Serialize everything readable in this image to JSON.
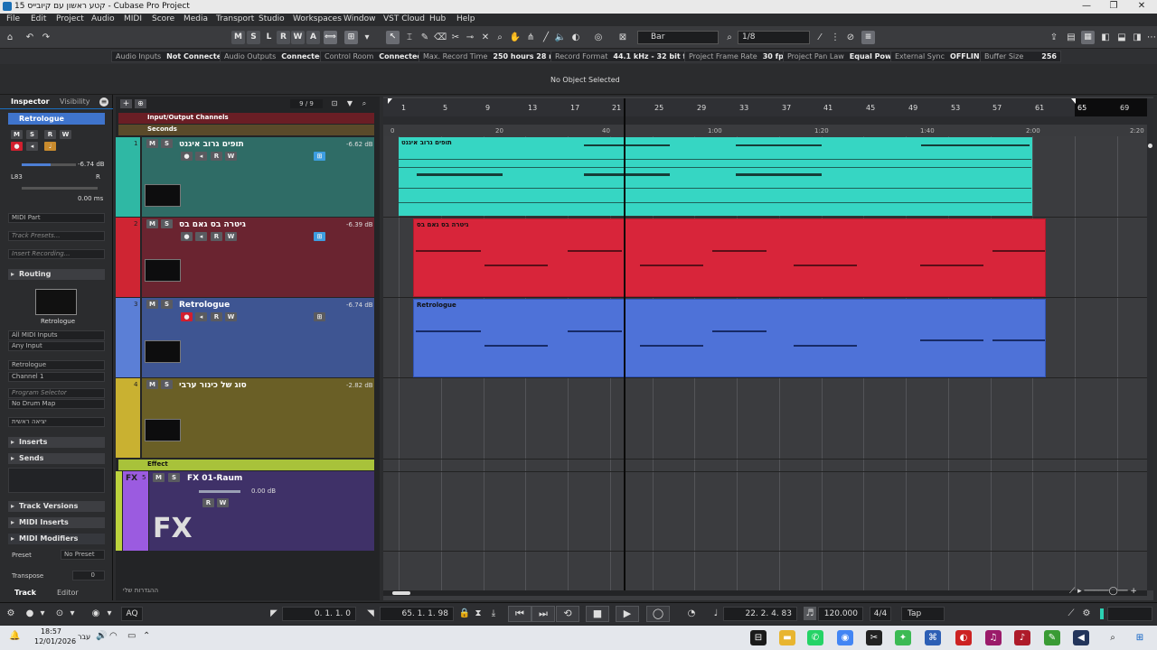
{
  "window": {
    "title": "קטע ראשון עם קיובייס 15 - Cubase Pro Project",
    "min": "—",
    "max": "❐",
    "close": "✕"
  },
  "menu": [
    "File",
    "Edit",
    "Project",
    "Audio",
    "MIDI",
    "Score",
    "Media",
    "Transport",
    "Studio",
    "Workspaces",
    "Window",
    "VST Cloud",
    "Hub",
    "Help"
  ],
  "toolbar": {
    "msl": [
      "M",
      "S",
      "L",
      "R",
      "W",
      "A"
    ],
    "grid_type": "Bar",
    "quantize": "1/8"
  },
  "status": [
    {
      "label": "Audio Inputs",
      "value": "Not Connected"
    },
    {
      "label": "Audio Outputs",
      "value": "Connected"
    },
    {
      "label": "Control Room",
      "value": "Connected"
    },
    {
      "label": "Max. Record Time",
      "value": "250 hours 28 mins"
    },
    {
      "label": "Record Format",
      "value": "44.1 kHz - 32 bit float"
    },
    {
      "label": "Project Frame Rate",
      "value": "30 fps"
    },
    {
      "label": "Project Pan Law",
      "value": "Equal Power"
    },
    {
      "label": "External Sync",
      "value": "OFFLINE"
    },
    {
      "label": "Buffer Size",
      "value": "256"
    }
  ],
  "info_line": "No Object Selected",
  "inspector": {
    "tabs": [
      "Inspector",
      "Visibility"
    ],
    "track_name": "Retrologue",
    "volume": "-6.74 dB",
    "pan_l": "L83",
    "pan_r": "R",
    "delay": "0.00 ms",
    "midi_part": "MIDI Part",
    "track_presets": "Track Presets...",
    "insert_recording": "Insert Recording...",
    "routing": "Routing",
    "instrument_label": "Retrologue",
    "midi_input": "All MIDI Inputs",
    "any_input": "Any Input",
    "output": "Retrologue",
    "channel": "Channel 1",
    "program_selector": "Program Selector",
    "drum_map": "No Drum Map",
    "output_name": "יציאה ראשית",
    "sections": [
      "Inserts",
      "Sends",
      "Track Versions",
      "MIDI Inserts",
      "MIDI Modifiers"
    ],
    "preset_label": "Preset",
    "preset_value": "No Preset",
    "transpose_label": "Transpose",
    "transpose_value": "0",
    "bottom_tabs": [
      "Track",
      "Editor"
    ]
  },
  "tracklist": {
    "count": "9 / 9",
    "io_label": "Input/Output Channels",
    "seconds_label": "Seconds",
    "tracks": [
      {
        "num": "1",
        "name": "תופים גרוב איגנט",
        "vol": "-6.62 dB",
        "color": "#2fb8a4",
        "body": "#2f6c66"
      },
      {
        "num": "2",
        "name": "גיטרה בס גאם בס",
        "vol": "-6.39 dB",
        "color": "#cf2533",
        "body": "#6a2430"
      },
      {
        "num": "3",
        "name": "Retrologue",
        "vol": "-6.74 dB",
        "color": "#5b7fd6",
        "body": "#3e5592"
      },
      {
        "num": "4",
        "name": "סוג של כינור ערבי",
        "vol": "-2.82 dB",
        "color": "#c9b131",
        "body": "#6a5f26"
      }
    ],
    "effect_folder": "Effect",
    "fx_track": {
      "num": "5",
      "name": "FX 01-Raum",
      "vol": "0.00 dB"
    },
    "footer": "ההגדרות שלי"
  },
  "ruler": {
    "bars": [
      "1",
      "5",
      "9",
      "13",
      "17",
      "21",
      "25",
      "29",
      "33",
      "37",
      "41",
      "45",
      "49",
      "53",
      "57",
      "61",
      "65",
      "69"
    ],
    "seconds": [
      "0",
      "20",
      "40",
      "1:00",
      "1:20",
      "1:40",
      "2:00",
      "2:20"
    ]
  },
  "parts": [
    {
      "name": "תופים גרוב איגנט",
      "color": "#36d6c3"
    },
    {
      "name": "גיטרה בס גאם בס",
      "color": "#d8253a"
    },
    {
      "name": "Retrologue",
      "color": "#4e72d8"
    }
  ],
  "transport": {
    "left_locator": "0. 1. 1.  0",
    "right_locator": "65. 1. 1. 98",
    "position": "22. 2. 4. 83",
    "tempo": "120.000",
    "signature": "4/4",
    "tap": "Tap",
    "aq": "AQ"
  },
  "taskbar": {
    "time": "18:57",
    "date": "12/01/2026",
    "lang": "עבר"
  }
}
